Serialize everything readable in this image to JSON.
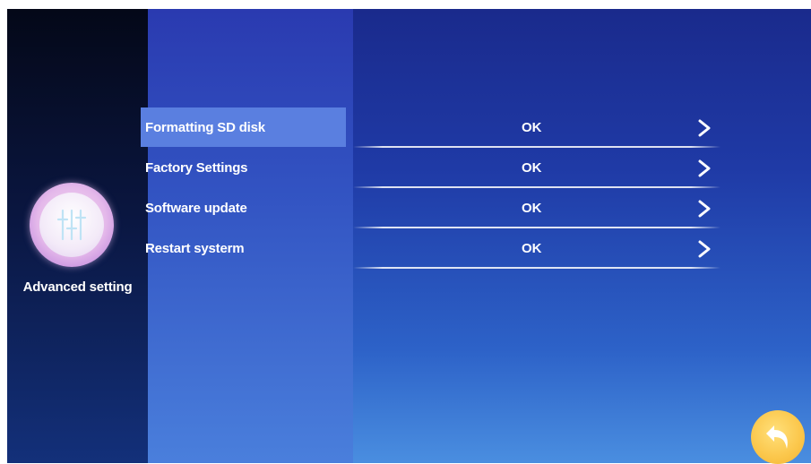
{
  "sidebar": {
    "category_label": "Advanced setting",
    "category_icon": "sliders-icon"
  },
  "menu": {
    "items": [
      {
        "label": "Formatting SD disk",
        "action": "OK",
        "selected": true
      },
      {
        "label": "Factory Settings",
        "action": "OK",
        "selected": false
      },
      {
        "label": "Software update",
        "action": "OK",
        "selected": false
      },
      {
        "label": "Restart systerm",
        "action": "OK",
        "selected": false
      }
    ]
  },
  "back_button": {
    "icon": "back-arrow-icon",
    "color": "#f7c04a"
  },
  "colors": {
    "accent": "#5a7fe0",
    "background": "#1f3aa6"
  }
}
